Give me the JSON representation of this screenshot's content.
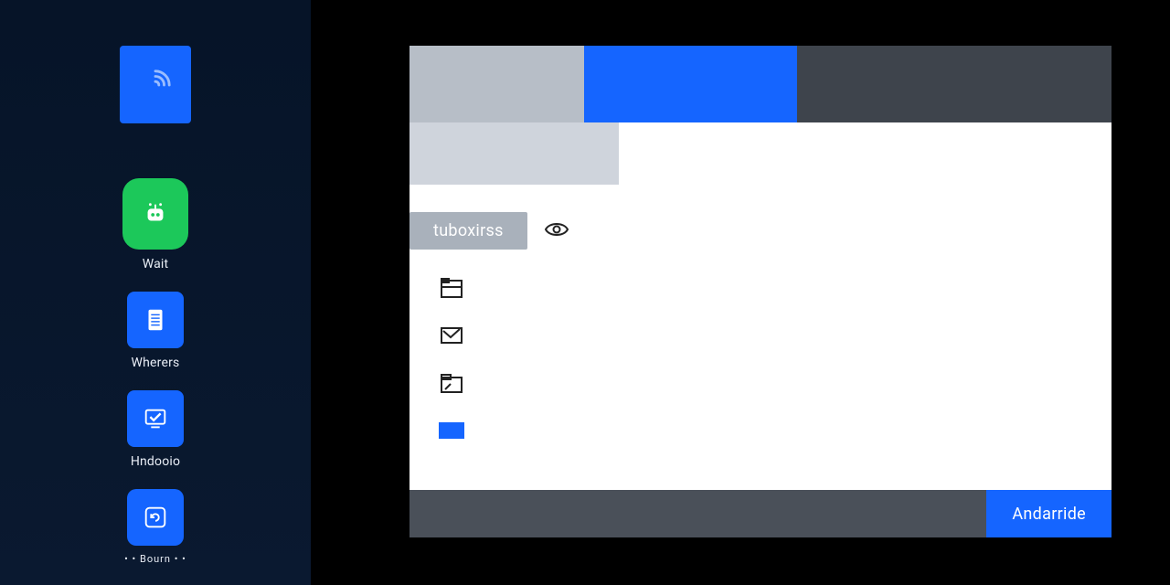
{
  "sidebar": {
    "items": [
      {
        "label": "Wait"
      },
      {
        "label": "Wherers"
      },
      {
        "label": "Hndooio"
      },
      {
        "label": "• • Bourn • •"
      }
    ]
  },
  "panel": {
    "chip_label": "tuboxirss"
  },
  "footer": {
    "action_label": "Andarride"
  }
}
